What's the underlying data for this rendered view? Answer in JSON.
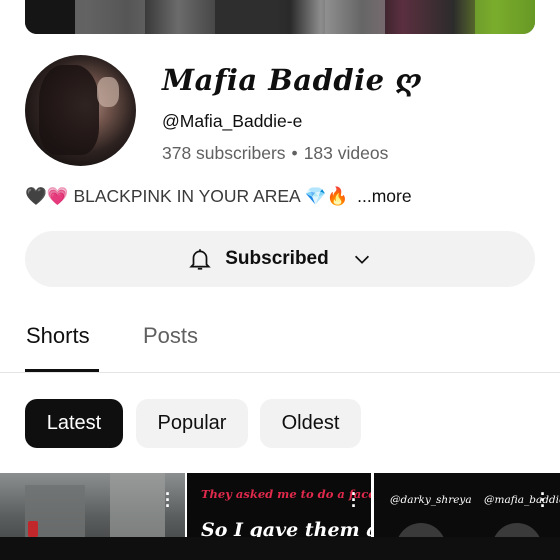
{
  "channel": {
    "name": "𝑴𝒂𝒇𝒊𝒂 𝑩𝒂𝒅𝒅𝒊𝒆 ღ",
    "handle": "@Mafia_Baddie-e",
    "subscribers": "378 subscribers",
    "separator": "•",
    "videos": "183 videos"
  },
  "description": {
    "emoji_prefix_1": "🖤",
    "emoji_prefix_2": "💗",
    "text": "BLACKPINK IN YOUR AREA",
    "emoji_suffix_1": "💎",
    "emoji_suffix_2": "🔥",
    "more_label": "...more"
  },
  "subscribe_button": {
    "label": "Subscribed",
    "icon": "bell-icon",
    "dropdown_icon": "chevron-down-icon"
  },
  "tabs": [
    {
      "label": "Shorts",
      "selected": true
    },
    {
      "label": "Posts",
      "selected": false
    }
  ],
  "filters": [
    {
      "label": "Latest",
      "selected": true
    },
    {
      "label": "Popular",
      "selected": false
    },
    {
      "label": "Oldest",
      "selected": false
    }
  ],
  "shorts": [
    {
      "overlay_text": ""
    },
    {
      "overlay_text": "They asked me to do a face reveal",
      "overlay_text_2": "So I gave them an"
    },
    {
      "tag_left": "@darky_shreya",
      "tag_right": "@mafia_baddie"
    }
  ],
  "colors": {
    "accent_text": "#0f0f0f",
    "secondary_text": "#606060",
    "chip_bg": "#f2f2f2",
    "chip_selected_bg": "#0f0f0f",
    "overlay_red": "#e0294b"
  }
}
